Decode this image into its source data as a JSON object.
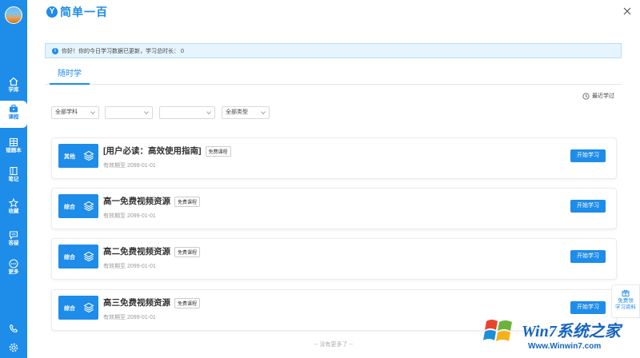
{
  "app": {
    "logo_mark": "Y",
    "name": "简单一百"
  },
  "sidebar": {
    "items": [
      {
        "label": "学库",
        "icon": "home-icon"
      },
      {
        "label": "课程",
        "icon": "briefcase-icon",
        "active": true
      },
      {
        "label": "错题本",
        "icon": "grid-book-icon"
      },
      {
        "label": "笔记",
        "icon": "notebook-icon"
      },
      {
        "label": "收藏",
        "icon": "star-icon"
      },
      {
        "label": "答疑",
        "icon": "chat-icon"
      },
      {
        "label": "更多",
        "icon": "more-icon"
      }
    ],
    "bottom": [
      {
        "icon": "phone-icon"
      },
      {
        "icon": "settings-icon"
      }
    ],
    "accent": "#1e8ce9"
  },
  "notice": {
    "text": "你好！你的今日学习数据已更新，学习总时长：  0"
  },
  "tabs": [
    {
      "label": "随时学",
      "active": true
    }
  ],
  "recent": {
    "label": "最近学过"
  },
  "filters": [
    {
      "value": "全部学科"
    },
    {
      "value": ""
    },
    {
      "value": ""
    },
    {
      "value": "全部类型"
    }
  ],
  "courses": [
    {
      "category": "其他",
      "title": "[用户必读：高效使用指南]",
      "badge": "免费课程",
      "expiry": "有效期至 2099-01-01",
      "button": "开始学习"
    },
    {
      "category": "综合",
      "title": "高一免费视频资源",
      "badge": "免费课程",
      "expiry": "有效期至 2099-01-01",
      "button": "开始学习"
    },
    {
      "category": "综合",
      "title": "高二免费视频资源",
      "badge": "免费课程",
      "expiry": "有效期至 2099-01-01",
      "button": "开始学习"
    },
    {
      "category": "综合",
      "title": "高三免费视频资源",
      "badge": "免费课程",
      "expiry": "有效期至 2099-01-01",
      "button": "开始学习"
    }
  ],
  "footer": {
    "no_more": "-- 没有更多了 --"
  },
  "promo": {
    "line1": "免费领",
    "line2": "学习资料"
  },
  "watermark": {
    "title": "Win7系统之家",
    "url": "Www.Winwin7.com"
  }
}
